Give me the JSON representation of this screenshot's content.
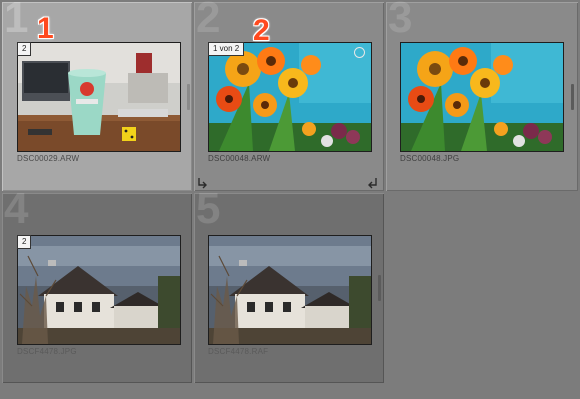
{
  "annotations": [
    "1",
    "2"
  ],
  "cells": [
    {
      "index": "1",
      "filename": "DSC00029.ARW",
      "stack_count": "2",
      "selected": true
    },
    {
      "index": "2",
      "filename": "DSC00048.ARW",
      "stack_count": "1 von 2",
      "selected": false
    },
    {
      "index": "3",
      "filename": "DSC00048.JPG",
      "stack_count": "",
      "selected": false
    },
    {
      "index": "4",
      "filename": "DSCF4478.JPG",
      "stack_count": "2",
      "selected": false
    },
    {
      "index": "5",
      "filename": "DSCF4478.RAF",
      "stack_count": "",
      "selected": false
    }
  ],
  "icons": {
    "collapse_left": "stack-collapse-left-icon",
    "collapse_right": "stack-collapse-right-icon",
    "marker": "unflagged-circle-icon"
  },
  "colors": {
    "annotation": "#ff4a1f",
    "background": "#7c7c7c",
    "selected_cell": "#a7a7a7"
  }
}
